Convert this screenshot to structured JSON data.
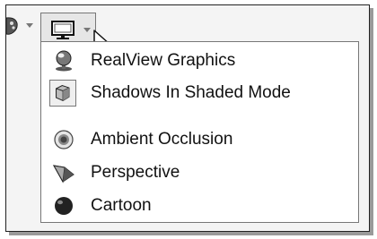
{
  "toolbar": {
    "left_icon": "appearance-icon",
    "display_button_icon": "monitor-icon",
    "dropdown_arrow_icon": "chevron-down-icon"
  },
  "menu": {
    "items": [
      {
        "label": "RealView Graphics",
        "icon": "realview-sphere-icon"
      },
      {
        "label": "Shadows In Shaded Mode",
        "icon": "shadow-cube-icon",
        "selected": true
      },
      {
        "label": "Ambient Occlusion",
        "icon": "ambient-occlusion-icon"
      },
      {
        "label": "Perspective",
        "icon": "perspective-icon"
      },
      {
        "label": "Cartoon",
        "icon": "cartoon-sphere-icon"
      }
    ]
  }
}
